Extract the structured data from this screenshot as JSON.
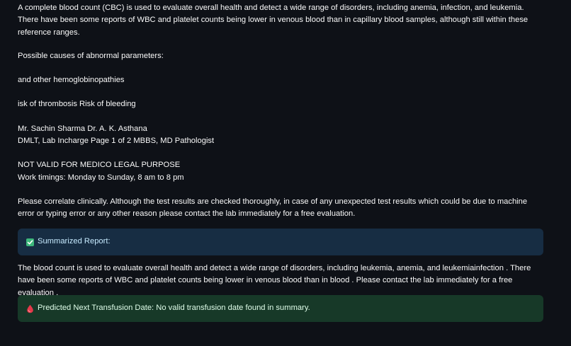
{
  "report": {
    "intro": "A complete blood count (CBC) is used to evaluate overall health and detect a wide range of disorders, including anemia, infection, and leukemia. There have been some reports of WBC and platelet counts being lower in venous blood than in capillary blood samples, although still within these reference ranges.",
    "causes_heading": "Possible causes of abnormal parameters:",
    "hemoglobinopathies": "and other hemoglobinopathies",
    "risks": "isk of thrombosis Risk of bleeding",
    "signatories_line1": "Mr. Sachin Sharma Dr. A. K. Asthana",
    "signatories_line2": "DMLT, Lab Incharge Page 1 of 2 MBBS, MD Pathologist",
    "medico_legal": "NOT VALID FOR MEDICO LEGAL PURPOSE",
    "work_timings": "Work timings: Monday to Sunday, 8 am to 8 pm",
    "disclaimer": "Please correlate clinically. Although the test results are checked thoroughly, in case of any unexpected test results which could be due to machine error or typing error or any other reason please contact the lab immediately for a free evaluation."
  },
  "summary_alert": {
    "icon": "check-box-icon",
    "label": "Summarized Report:",
    "color": "#172d43"
  },
  "summary": {
    "text": "The blood count is used to evaluate overall health and detect a wide range of disorders, including leukemia, anemia, and leukemiainfection . There have been some reports of WBC and platelet counts being lower in venous blood than in blood . Please contact the lab immediately for a free evaluation ."
  },
  "transfusion_alert": {
    "icon": "blood-drop-icon",
    "label": "Predicted Next Transfusion Date: No valid transfusion date found in summary.",
    "color": "#173928"
  }
}
